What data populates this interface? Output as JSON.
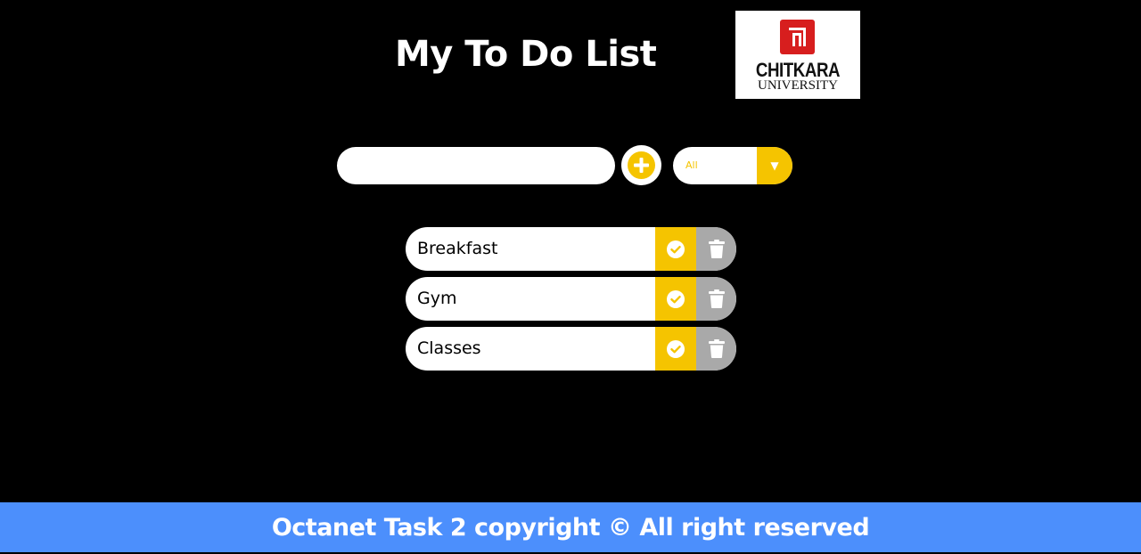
{
  "header": {
    "title": "My To Do List",
    "logo": {
      "line1": "CHITKARA",
      "line2": "UNIVERSITY",
      "brand_color": "#d71e1e"
    }
  },
  "form": {
    "input_value": "",
    "add_icon": "plus-circle-icon",
    "filter_selected": "All",
    "filter_arrow": "▼"
  },
  "todos": [
    {
      "label": "Breakfast"
    },
    {
      "label": "Gym"
    },
    {
      "label": "Classes"
    }
  ],
  "item_actions": {
    "complete_icon": "check-circle-icon",
    "delete_icon": "trash-icon"
  },
  "footer": {
    "text": "Octanet Task 2 copyright © All right reserved"
  },
  "colors": {
    "background": "#000000",
    "accent": "#f5c400",
    "delete": "#a9a9a9",
    "footer": "#4c8ffc"
  }
}
